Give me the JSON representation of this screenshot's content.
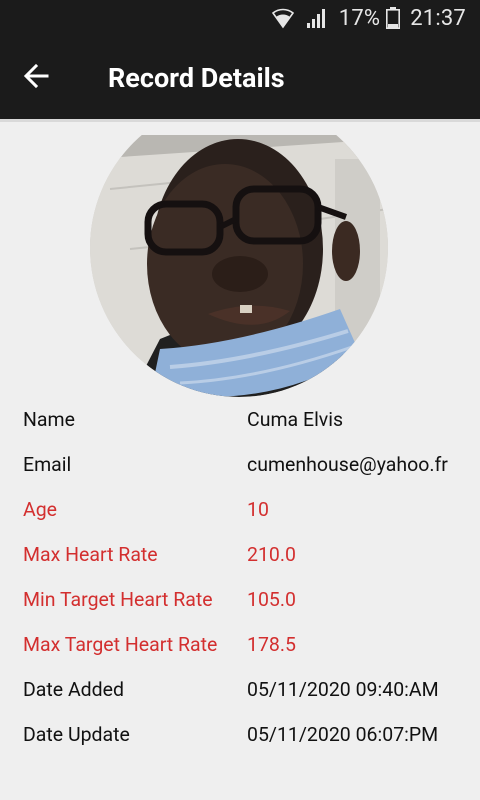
{
  "status_bar": {
    "battery_percent": "17%",
    "time": "21:37",
    "icons": [
      "wifi-icon",
      "cellular-signal-icon",
      "battery-icon"
    ]
  },
  "app_bar": {
    "title": "Record Details",
    "back_icon": "arrow-back-icon"
  },
  "colors": {
    "highlight": "#d32f2f",
    "app_bar": "#1b1b1b",
    "background": "#efefef"
  },
  "fields": [
    {
      "label": "Name",
      "value": "Cuma Elvis",
      "highlight": false
    },
    {
      "label": "Email",
      "value": "cumenhouse@yahoo.fr",
      "highlight": false
    },
    {
      "label": "Age",
      "value": "10",
      "highlight": true
    },
    {
      "label": "Max Heart Rate",
      "value": "210.0",
      "highlight": true
    },
    {
      "label": "Min Target Heart Rate",
      "value": "105.0",
      "highlight": true
    },
    {
      "label": "Max Target Heart Rate",
      "value": "178.5",
      "highlight": true
    },
    {
      "label": "Date Added",
      "value": "05/11/2020 09:40:AM",
      "highlight": false
    },
    {
      "label": "Date Update",
      "value": "05/11/2020 06:07:PM",
      "highlight": false
    }
  ]
}
